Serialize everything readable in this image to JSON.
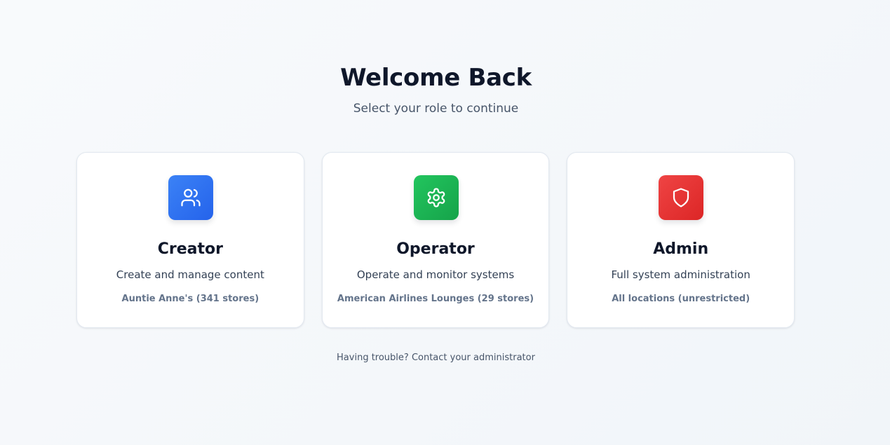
{
  "header": {
    "title": "Welcome Back",
    "subtitle": "Select your role to continue"
  },
  "roles": [
    {
      "title": "Creator",
      "description": "Create and manage content",
      "scope": "Auntie Anne's (341 stores)",
      "icon": "users-icon",
      "color": "#3b82f6"
    },
    {
      "title": "Operator",
      "description": "Operate and monitor systems",
      "scope": "American Airlines Lounges (29 stores)",
      "icon": "gear-icon",
      "color": "#22c55e"
    },
    {
      "title": "Admin",
      "description": "Full system administration",
      "scope": "All locations (unrestricted)",
      "icon": "shield-icon",
      "color": "#ef4444"
    }
  ],
  "footer": {
    "help_text": "Having trouble? Contact your administrator"
  }
}
